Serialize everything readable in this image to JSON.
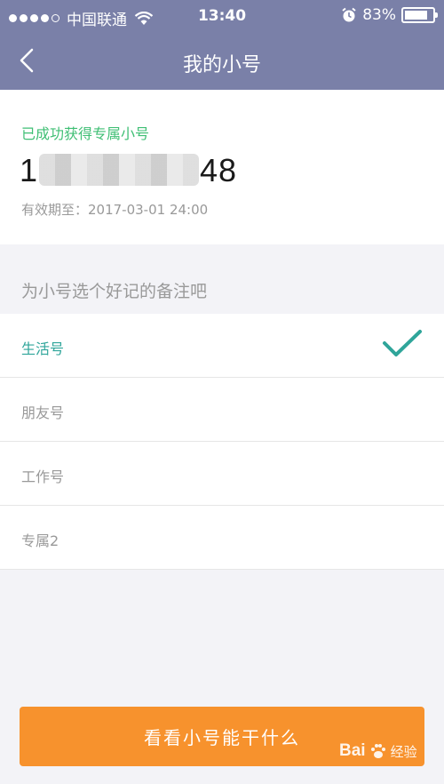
{
  "status_bar": {
    "carrier": "中国联通",
    "time": "13:40",
    "battery": "83%",
    "battery_level": 0.83,
    "signal_icon": "signal-dots-icon",
    "wifi_icon": "wifi-icon",
    "alarm_icon": "alarm-clock-icon"
  },
  "nav": {
    "title": "我的小号",
    "back_icon": "chevron-left-icon"
  },
  "info": {
    "success_text": "已成功获得专属小号",
    "number_prefix": "1",
    "number_suffix": "48",
    "expiry": "有效期至：2017-03-01 24:00"
  },
  "section_label": "为小号选个好记的备注吧",
  "options": [
    {
      "label": "生活号",
      "selected": true
    },
    {
      "label": "朋友号",
      "selected": false
    },
    {
      "label": "工作号",
      "selected": false
    },
    {
      "label": "专属2",
      "selected": false
    }
  ],
  "cta_label": "看看小号能干什么",
  "watermark": {
    "brand": "Bai",
    "text": "经验"
  },
  "colors": {
    "header": "#7a80a8",
    "success": "#3fbf74",
    "selected": "#2fa59a",
    "cta": "#f7922d"
  }
}
